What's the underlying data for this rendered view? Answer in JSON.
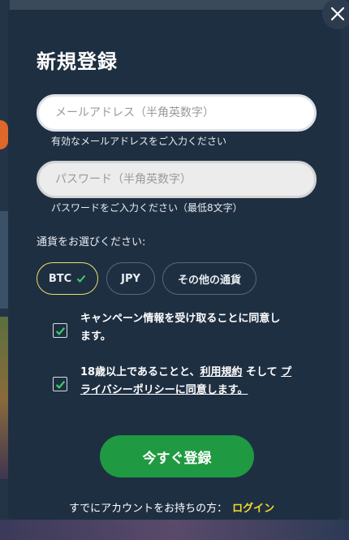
{
  "modal": {
    "title": "新規登録",
    "email": {
      "placeholder": "メールアドレス（半角英数字）",
      "hint": "有効なメールアドレスをご入力ください"
    },
    "password": {
      "placeholder": "パスワード（半角英数字）",
      "hint": "パスワードをご入力ください（最低8文字）"
    },
    "currency": {
      "label": "通貨をお選びください:",
      "options": [
        {
          "label": "BTC",
          "selected": true
        },
        {
          "label": "JPY",
          "selected": false
        },
        {
          "label": "その他の通貨",
          "selected": false
        }
      ]
    },
    "checkboxes": {
      "campaign": {
        "line1": "キャンペーン情報を受け取ることに同意し",
        "line2": "ます。",
        "checked": true
      },
      "terms": {
        "prefix": "18歳以上であることと、",
        "terms_link": "利用規約",
        "middle": " そして ",
        "privacy_link_part1": "プ",
        "privacy_link_part2": "ライバシーポリシーに同意します。",
        "checked": true
      }
    },
    "submit_label": "今すぐ登録",
    "login_prompt": "すでにアカウントをお持ちの方：",
    "login_link": "ログイン"
  },
  "colors": {
    "accent_green": "#1f9a42",
    "check_green": "#3cd068",
    "login_yellow": "#f2da2a",
    "modal_bg": "#1f2f42"
  }
}
